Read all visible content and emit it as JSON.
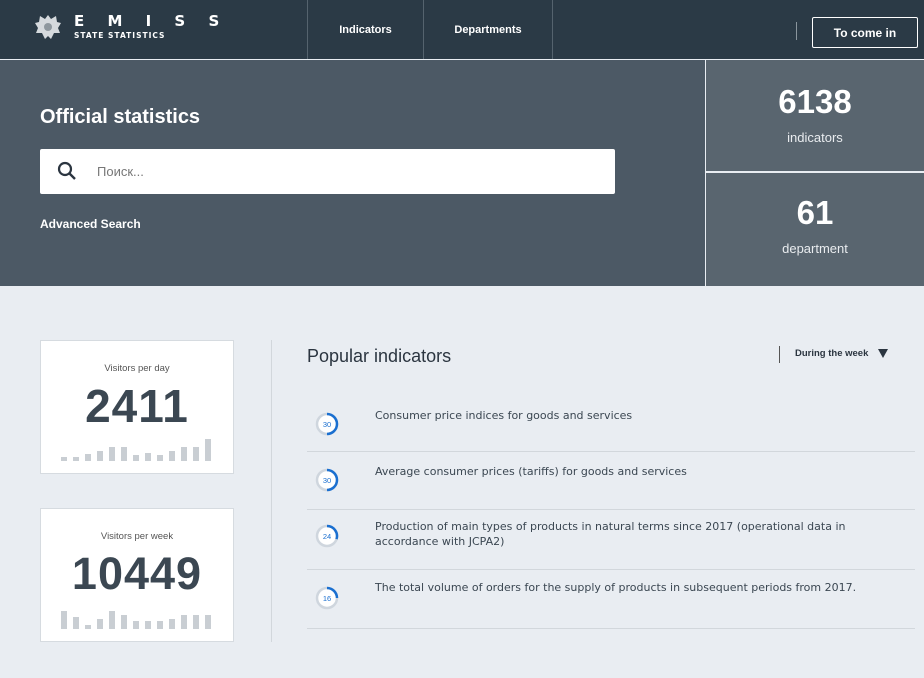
{
  "header": {
    "brand_title": "E M I S S",
    "brand_subtitle": "STATE STATISTICS",
    "nav": [
      "Indicators",
      "Departments"
    ],
    "login_label": "To come in"
  },
  "hero": {
    "title": "Official statistics",
    "search_placeholder": "Поиск...",
    "advanced_search": "Advanced Search",
    "stats": [
      {
        "value": "6138",
        "label": "indicators"
      },
      {
        "value": "61",
        "label": "department"
      }
    ]
  },
  "visitors": {
    "day": {
      "label": "Visitors per day",
      "value": "2411"
    },
    "week": {
      "label": "Visitors per week",
      "value": "10449"
    }
  },
  "popular": {
    "title": "Popular indicators",
    "period": "During the week",
    "items": [
      {
        "count": "30",
        "text": "Consumer price indices for goods and services"
      },
      {
        "count": "30",
        "text": "Average consumer prices (tariffs) for goods and services"
      },
      {
        "count": "24",
        "text": "Production of main types of products in natural terms since 2017 (operational data in accordance with JCPA2)"
      },
      {
        "count": "16",
        "text": "The total volume of orders for the supply of products in subsequent periods from 2017."
      }
    ]
  },
  "colors": {
    "nav_bg": "#2b3a46",
    "hero_bg": "#4c5965",
    "stat_bg": "#59656f",
    "page_bg": "#e9edf2",
    "accent": "#1a6fd0"
  }
}
